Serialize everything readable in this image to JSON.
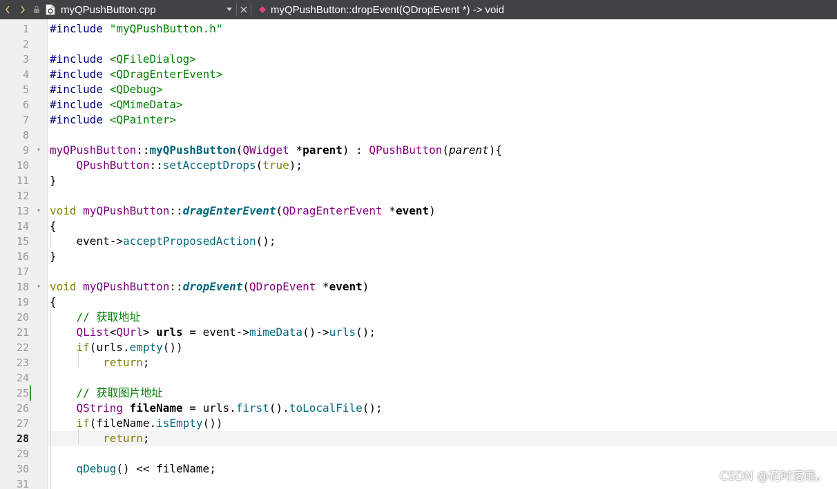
{
  "toolbar": {
    "back_icon": "chevron-left-icon",
    "forward_icon": "chevron-right-icon",
    "lock_icon": "lock-icon",
    "file_icon": "cpp-file-icon",
    "file_name": "myQPushButton.cpp",
    "close_icon": "close-icon",
    "symbol_icon": "function-symbol-icon",
    "symbol_name": "myQPushButton::dropEvent(QDropEvent *) -> void"
  },
  "editor": {
    "current_line": 28,
    "changed_line": 25,
    "fold_lines": [
      9,
      13,
      18
    ],
    "lines": [
      {
        "n": "1",
        "tokens": [
          [
            "pp",
            "#include "
          ],
          [
            "str",
            "\"myQPushButton.h\""
          ]
        ]
      },
      {
        "n": "2",
        "tokens": []
      },
      {
        "n": "3",
        "tokens": [
          [
            "pp",
            "#include "
          ],
          [
            "str",
            "<QFileDialog>"
          ]
        ]
      },
      {
        "n": "4",
        "tokens": [
          [
            "pp",
            "#include "
          ],
          [
            "str",
            "<QDragEnterEvent>"
          ]
        ]
      },
      {
        "n": "5",
        "tokens": [
          [
            "pp",
            "#include "
          ],
          [
            "str",
            "<QDebug>"
          ]
        ]
      },
      {
        "n": "6",
        "tokens": [
          [
            "pp",
            "#include "
          ],
          [
            "str",
            "<QMimeData>"
          ]
        ]
      },
      {
        "n": "7",
        "tokens": [
          [
            "pp",
            "#include "
          ],
          [
            "str",
            "<QPainter>"
          ]
        ]
      },
      {
        "n": "8",
        "tokens": []
      },
      {
        "n": "9",
        "tokens": [
          [
            "cls",
            "myQPushButton"
          ],
          [
            "",
            "::"
          ],
          [
            "fnb",
            "myQPushButton"
          ],
          [
            "",
            "("
          ],
          [
            "cls",
            "QWidget"
          ],
          [
            "",
            " *"
          ],
          [
            "bold",
            "parent"
          ],
          [
            "",
            ") : "
          ],
          [
            "cls",
            "QPushButton"
          ],
          [
            "",
            "("
          ],
          [
            "par",
            "parent"
          ],
          [
            "",
            "){"
          ]
        ]
      },
      {
        "n": "10",
        "tokens": [
          [
            "",
            "    "
          ],
          [
            "cls",
            "QPushButton"
          ],
          [
            "",
            "::"
          ],
          [
            "fn",
            "setAcceptDrops"
          ],
          [
            "",
            "("
          ],
          [
            "kw",
            "true"
          ],
          [
            "",
            ");"
          ]
        ]
      },
      {
        "n": "11",
        "tokens": [
          [
            "",
            "}"
          ]
        ]
      },
      {
        "n": "12",
        "tokens": []
      },
      {
        "n": "13",
        "tokens": [
          [
            "kw",
            "void"
          ],
          [
            "",
            " "
          ],
          [
            "cls",
            "myQPushButton"
          ],
          [
            "",
            "::"
          ],
          [
            "fni",
            "dragEnterEvent"
          ],
          [
            "",
            "("
          ],
          [
            "cls",
            "QDragEnterEvent"
          ],
          [
            "",
            " *"
          ],
          [
            "bold",
            "event"
          ],
          [
            "",
            ")"
          ]
        ]
      },
      {
        "n": "14",
        "tokens": [
          [
            "",
            "{"
          ]
        ]
      },
      {
        "n": "15",
        "tokens": [
          [
            "",
            "    event->"
          ],
          [
            "fn",
            "acceptProposedAction"
          ],
          [
            "",
            "();"
          ]
        ]
      },
      {
        "n": "16",
        "tokens": [
          [
            "",
            "}"
          ]
        ]
      },
      {
        "n": "17",
        "tokens": []
      },
      {
        "n": "18",
        "tokens": [
          [
            "kw",
            "void"
          ],
          [
            "",
            " "
          ],
          [
            "cls",
            "myQPushButton"
          ],
          [
            "",
            "::"
          ],
          [
            "fni",
            "dropEvent"
          ],
          [
            "",
            "("
          ],
          [
            "cls",
            "QDropEvent"
          ],
          [
            "",
            " *"
          ],
          [
            "bold",
            "event"
          ],
          [
            "",
            ")"
          ]
        ]
      },
      {
        "n": "19",
        "tokens": [
          [
            "",
            "{"
          ]
        ]
      },
      {
        "n": "20",
        "tokens": [
          [
            "",
            "    "
          ],
          [
            "cm",
            "// 获取地址"
          ]
        ]
      },
      {
        "n": "21",
        "tokens": [
          [
            "",
            "    "
          ],
          [
            "cls",
            "QList"
          ],
          [
            "",
            "<"
          ],
          [
            "cls",
            "QUrl"
          ],
          [
            "",
            "> "
          ],
          [
            "bold",
            "urls"
          ],
          [
            "",
            " = event->"
          ],
          [
            "fn",
            "mimeData"
          ],
          [
            "",
            "()->"
          ],
          [
            "fn",
            "urls"
          ],
          [
            "",
            "();"
          ]
        ]
      },
      {
        "n": "22",
        "tokens": [
          [
            "",
            "    "
          ],
          [
            "kw",
            "if"
          ],
          [
            "",
            "(urls."
          ],
          [
            "fn",
            "empty"
          ],
          [
            "",
            "())"
          ]
        ]
      },
      {
        "n": "23",
        "tokens": [
          [
            "",
            "        "
          ],
          [
            "kw",
            "return"
          ],
          [
            "",
            ";"
          ]
        ]
      },
      {
        "n": "24",
        "tokens": []
      },
      {
        "n": "25",
        "tokens": [
          [
            "",
            "    "
          ],
          [
            "cm",
            "// 获取图片地址"
          ]
        ]
      },
      {
        "n": "26",
        "tokens": [
          [
            "",
            "    "
          ],
          [
            "cls",
            "QString"
          ],
          [
            "",
            " "
          ],
          [
            "bold",
            "fileName"
          ],
          [
            "",
            " = urls."
          ],
          [
            "fn",
            "first"
          ],
          [
            "",
            "()."
          ],
          [
            "fn",
            "toLocalFile"
          ],
          [
            "",
            "();"
          ]
        ]
      },
      {
        "n": "27",
        "tokens": [
          [
            "",
            "    "
          ],
          [
            "kw",
            "if"
          ],
          [
            "",
            "(fileName."
          ],
          [
            "fn",
            "isEmpty"
          ],
          [
            "",
            "())"
          ]
        ]
      },
      {
        "n": "28",
        "tokens": [
          [
            "",
            "        "
          ],
          [
            "kw",
            "return"
          ],
          [
            "",
            ";"
          ]
        ]
      },
      {
        "n": "29",
        "tokens": []
      },
      {
        "n": "30",
        "tokens": [
          [
            "",
            "    "
          ],
          [
            "fn",
            "qDebug"
          ],
          [
            "",
            "() << fileName;"
          ]
        ]
      },
      {
        "n": "31",
        "tokens": []
      }
    ]
  },
  "watermark": "CSDN @花时落雨。"
}
